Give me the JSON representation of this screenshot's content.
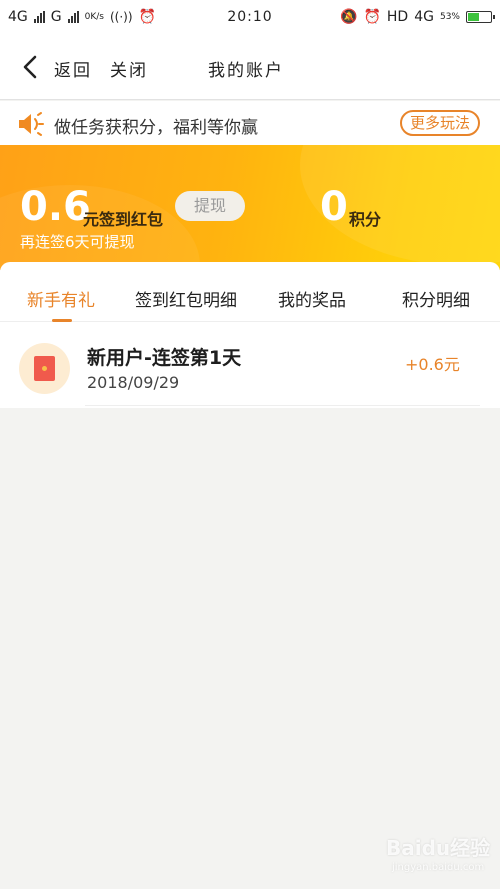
{
  "status_bar": {
    "network1": "4G",
    "network2": "G",
    "speed": "0K/s",
    "time": "20:10",
    "hd": "HD",
    "network3": "4G",
    "battery_pct": "53%",
    "battery_level": 0.53
  },
  "nav": {
    "back_label": "返回",
    "close_label": "关闭",
    "title": "我的账户"
  },
  "notice": {
    "icon": "speaker-icon",
    "text": "做任务获积分，福利等你赢",
    "more_label": "更多玩法"
  },
  "banner": {
    "amount": "0.6",
    "amount_label": "元签到红包",
    "withdraw_label": "提现",
    "sub_note": "再连签6天可提现",
    "points": "0",
    "points_label": "积分"
  },
  "tabs": [
    {
      "label": "新手有礼",
      "active": true
    },
    {
      "label": "签到红包明细",
      "active": false
    },
    {
      "label": "我的奖品",
      "active": false
    },
    {
      "label": "积分明细",
      "active": false
    }
  ],
  "records": [
    {
      "icon": "red-envelope-icon",
      "title": "新用户-连签第1天",
      "date": "2018/09/29",
      "amount": "+0.6元"
    }
  ],
  "watermark": {
    "text": "Baidu经验",
    "sub": "jingyan.baidu.com"
  },
  "colors": {
    "accent": "#e8842a",
    "banner_start": "#ffa117",
    "banner_end": "#ffd60b"
  }
}
